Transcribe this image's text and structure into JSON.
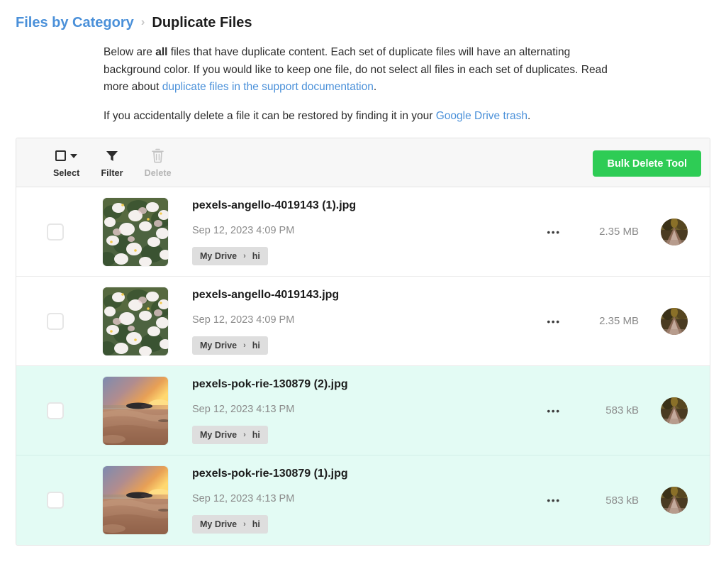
{
  "breadcrumb": {
    "parent": "Files by Category",
    "separator": "›",
    "current": "Duplicate Files"
  },
  "intro": {
    "p1_a": "Below are ",
    "p1_bold": "all",
    "p1_b": " files that have duplicate content. Each set of duplicate files will have an alternating background color. If you would like to keep one file, do not select all files in each set of duplicates. Read more about ",
    "p1_link": "duplicate files in the support documentation",
    "p1_c": ".",
    "p2_a": "If you accidentally delete a file it can be restored by finding it in your ",
    "p2_link": "Google Drive trash",
    "p2_b": "."
  },
  "toolbar": {
    "select_label": "Select",
    "select_icon": "checkbox-dropdown-icon",
    "filter_label": "Filter",
    "filter_icon": "funnel-icon",
    "delete_label": "Delete",
    "delete_icon": "trash-icon",
    "delete_disabled": true,
    "bulk_delete_label": "Bulk Delete Tool",
    "bulk_delete_color": "#2ecc55"
  },
  "colors": {
    "link": "#4a90d9",
    "alt_row_background": "#e3fbf4",
    "toolbar_background": "#f7f7f7",
    "pill_background": "#dedede"
  },
  "files": [
    {
      "name": "pexels-angello-4019143 (1).jpg",
      "date": "Sep 12, 2023 4:09 PM",
      "drive": "My Drive",
      "drive_sep": "›",
      "folder": "hi",
      "size": "2.35 MB",
      "menu": "•••",
      "thumb": "flowers",
      "alt": false
    },
    {
      "name": "pexels-angello-4019143.jpg",
      "date": "Sep 12, 2023 4:09 PM",
      "drive": "My Drive",
      "drive_sep": "›",
      "folder": "hi",
      "size": "2.35 MB",
      "menu": "•••",
      "thumb": "flowers",
      "alt": false
    },
    {
      "name": "pexels-pok-rie-130879 (2).jpg",
      "date": "Sep 12, 2023 4:13 PM",
      "drive": "My Drive",
      "drive_sep": "›",
      "folder": "hi",
      "size": "583 kB",
      "menu": "•••",
      "thumb": "sunset",
      "alt": true
    },
    {
      "name": "pexels-pok-rie-130879 (1).jpg",
      "date": "Sep 12, 2023 4:13 PM",
      "drive": "My Drive",
      "drive_sep": "›",
      "folder": "hi",
      "size": "583 kB",
      "menu": "•••",
      "thumb": "sunset",
      "alt": true
    }
  ]
}
